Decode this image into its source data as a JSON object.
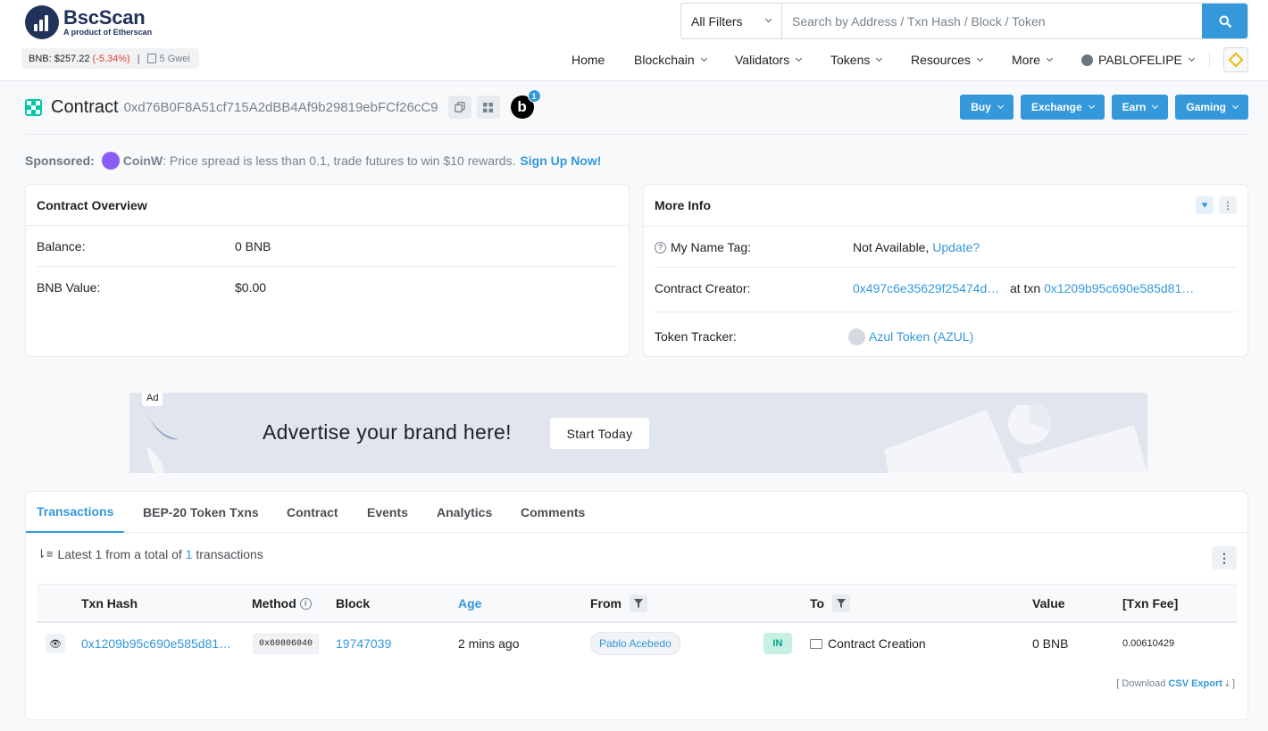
{
  "brand": {
    "name": "BscScan",
    "subtitle": "A product of Etherscan"
  },
  "ticker": {
    "price": "BNB: $257.22",
    "change": "(-5.34%)",
    "separator": "|",
    "gas": "5 Gwei"
  },
  "search": {
    "filter_label": "All Filters",
    "placeholder": "Search by Address / Txn Hash / Block / Token"
  },
  "nav": {
    "home": "Home",
    "blockchain": "Blockchain",
    "validators": "Validators",
    "tokens": "Tokens",
    "resources": "Resources",
    "more": "More",
    "user": "PABLOFELIPE"
  },
  "page": {
    "type_label": "Contract",
    "address": "0xd76B0F8A51cf715A2dBB4Af9b29819ebFCf26cC9",
    "badge_letter": "b",
    "badge_count": "1"
  },
  "actions": {
    "buy": "Buy",
    "exchange": "Exchange",
    "earn": "Earn",
    "gaming": "Gaming"
  },
  "sponsored": {
    "label": "Sponsored:",
    "brand": "CoinW",
    "text": ": Price spread is less than 0.1, trade futures to win $10 rewards.",
    "cta": "Sign Up Now!"
  },
  "overview": {
    "title": "Contract Overview",
    "balance_label": "Balance:",
    "balance_value": "0 BNB",
    "value_label": "BNB Value:",
    "value_value": "$0.00"
  },
  "more_info": {
    "title": "More Info",
    "name_tag_label": "My Name Tag:",
    "name_tag_value": "Not Available,",
    "name_tag_link": "Update?",
    "creator_label": "Contract Creator:",
    "creator_address": "0x497c6e35629f25474d…",
    "creator_at": "at txn",
    "creator_txn": "0x1209b95c690e585d81…",
    "tracker_label": "Token Tracker:",
    "tracker_value": "Azul Token (AZUL)"
  },
  "ad": {
    "tag": "Ad",
    "headline": "Advertise your brand here!",
    "cta": "Start Today"
  },
  "tabs": [
    "Transactions",
    "BEP-20 Token Txns",
    "Contract",
    "Events",
    "Analytics",
    "Comments"
  ],
  "summary": {
    "prefix": "Latest 1 from a total of",
    "count": "1",
    "suffix": "transactions"
  },
  "table": {
    "headers": {
      "hash": "Txn Hash",
      "method": "Method",
      "block": "Block",
      "age": "Age",
      "from": "From",
      "to": "To",
      "value": "Value",
      "fee": "[Txn Fee]"
    },
    "rows": [
      {
        "hash": "0x1209b95c690e585d81…",
        "method": "0x60806040",
        "block": "19747039",
        "age": "2 mins ago",
        "from": "Pablo Acebedo",
        "direction": "IN",
        "to": "Contract Creation",
        "value": "0 BNB",
        "fee": "0.00610429"
      }
    ]
  },
  "export": {
    "prefix": "[ Download",
    "link": "CSV Export",
    "suffix": "]"
  },
  "colors": {
    "primary": "#3498db",
    "brand_dark": "#21325b",
    "bnb_yellow": "#f0b90b",
    "negative": "#de4437",
    "success": "#00c9a7"
  }
}
